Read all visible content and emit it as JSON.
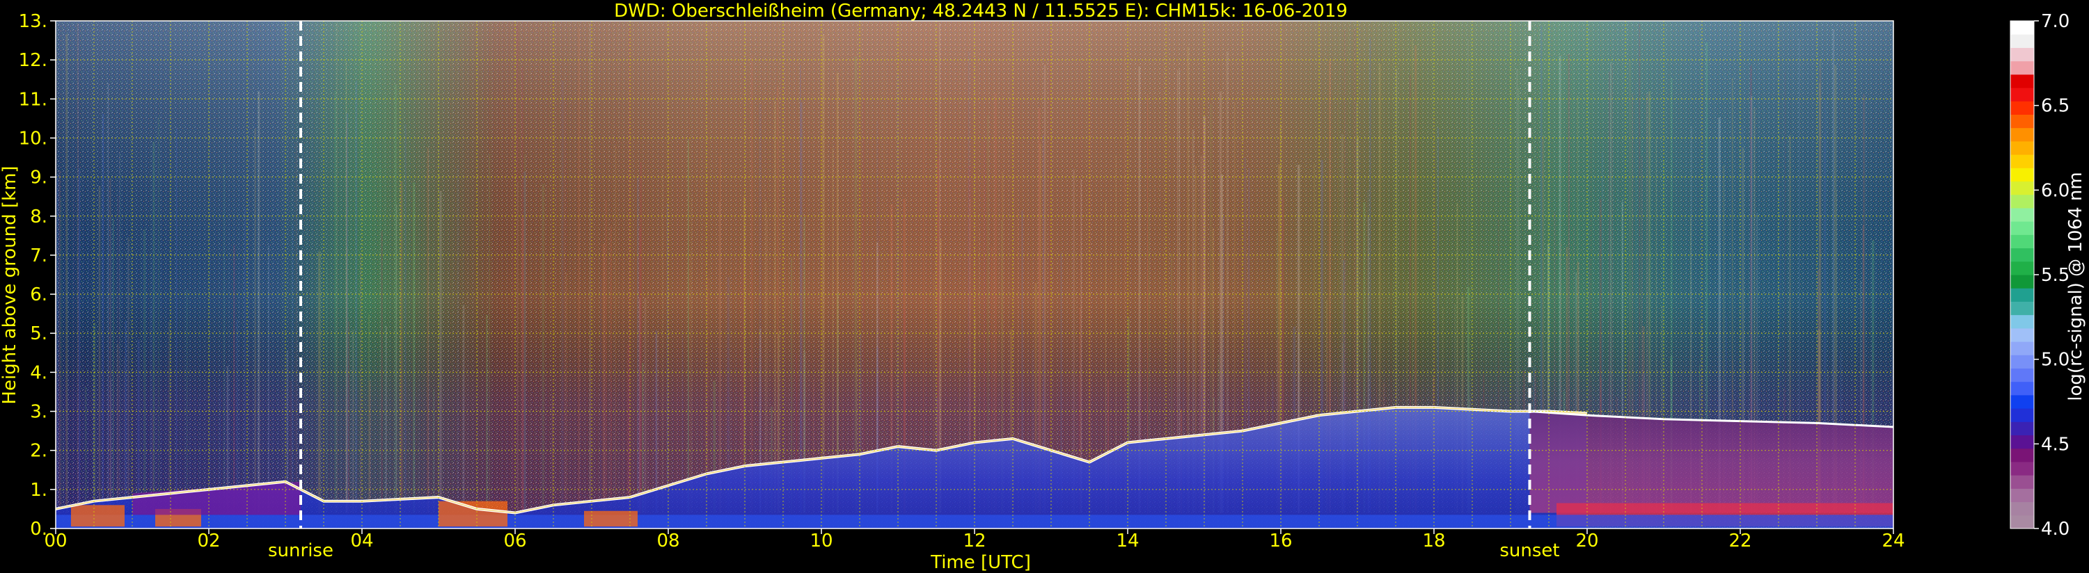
{
  "chart_data": {
    "type": "heatmap",
    "title": "DWD: Oberschleißheim (Germany; 48.2443 N / 11.5525 E):    CHM15k: 16-06-2019",
    "xlabel": "Time [UTC]",
    "ylabel": "Height above ground [km]",
    "xlim": [
      0,
      24
    ],
    "ylim": [
      0,
      13
    ],
    "x_ticks": [
      "00",
      "02",
      "04",
      "06",
      "08",
      "10",
      "12",
      "14",
      "16",
      "18",
      "20",
      "22",
      "24"
    ],
    "y_ticks": [
      "0.",
      "1.",
      "2.",
      "3.",
      "4.",
      "5.",
      "6.",
      "7.",
      "8.",
      "9.",
      "10.",
      "11.",
      "12.",
      "13."
    ],
    "grid": true,
    "annotations": [
      {
        "text": "sunrise",
        "x": 3.2
      },
      {
        "text": "sunset",
        "x": 19.25
      }
    ],
    "colorbar": {
      "label": "log(rc-signal) @ 1064 nm",
      "range": [
        4.0,
        7.0
      ],
      "ticks": [
        "4.0",
        "4.5",
        "5.0",
        "5.5",
        "6.0",
        "6.5",
        "7.0"
      ],
      "colors": [
        "#a98aa3",
        "#a782a2",
        "#a56f9f",
        "#9a4f92",
        "#8a2a83",
        "#7a1476",
        "#5a1294",
        "#3a22b4",
        "#2030d8",
        "#1040f0",
        "#4060f8",
        "#6078f8",
        "#7890f8",
        "#90a8f8",
        "#a0c0f8",
        "#80c8e8",
        "#40b0a8",
        "#20a090",
        "#109838",
        "#20b048",
        "#30c060",
        "#50d878",
        "#70e890",
        "#90f0a0",
        "#b0f060",
        "#d8f030",
        "#f8f000",
        "#ffd000",
        "#ffb000",
        "#ff9000",
        "#ff6000",
        "#ff3000",
        "#f01010",
        "#e00000",
        "#f0a0a8",
        "#f0c8d0",
        "#f0f0f0",
        "#ffffff"
      ]
    },
    "boundary_layer_top_km": {
      "x": [
        0.0,
        0.5,
        1.0,
        1.5,
        2.0,
        2.5,
        3.0,
        3.5,
        4.0,
        4.5,
        5.0,
        5.5,
        6.0,
        6.5,
        7.0,
        7.5,
        8.0,
        8.5,
        9.0,
        9.5,
        10.0,
        10.5,
        11.0,
        11.5,
        12.0,
        12.5,
        13.0,
        13.5,
        14.0,
        14.5,
        15.0,
        15.5,
        16.0,
        16.5,
        17.0,
        17.5,
        18.0,
        18.5,
        19.0,
        19.5,
        20.0
      ],
      "y": [
        0.5,
        0.7,
        0.8,
        0.9,
        1.0,
        1.1,
        1.2,
        0.7,
        0.7,
        0.75,
        0.8,
        0.5,
        0.4,
        0.6,
        0.7,
        0.8,
        1.1,
        1.4,
        1.6,
        1.7,
        1.8,
        1.9,
        2.1,
        2.0,
        2.2,
        2.3,
        2.0,
        1.7,
        2.2,
        2.3,
        2.4,
        2.5,
        2.7,
        2.9,
        3.0,
        3.1,
        3.1,
        3.05,
        3.0,
        3.0,
        2.95
      ]
    },
    "residual_layer_top_km": {
      "x": [
        19.25,
        20,
        21,
        22,
        23,
        24
      ],
      "y": [
        3.0,
        2.9,
        2.8,
        2.75,
        2.7,
        2.6
      ]
    }
  },
  "colors": {
    "text": "#ffff00",
    "background": "#000000",
    "grid": "#d8d800",
    "marker_line": "#ffffff"
  }
}
